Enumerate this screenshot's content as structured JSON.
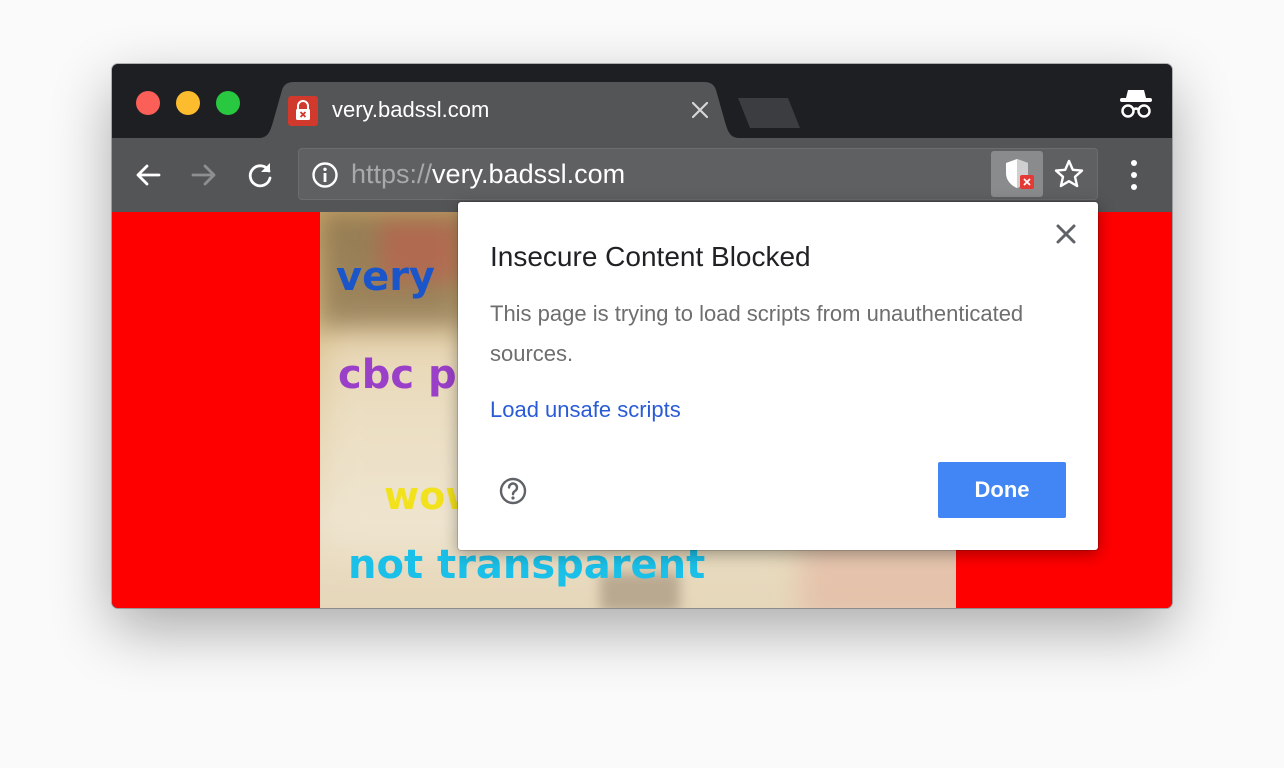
{
  "window": {
    "traffic_lights": {
      "close": "#fc5f57",
      "minimize": "#fdbc2e",
      "maximize": "#28c840"
    }
  },
  "tab": {
    "title": "very.badssl.com",
    "favicon_icon": "lock-error-icon",
    "close_icon": "close-icon"
  },
  "toolbar": {
    "back_icon": "arrow-left-icon",
    "forward_icon": "arrow-right-icon",
    "reload_icon": "reload-icon",
    "omnibox": {
      "info_icon": "info-icon",
      "url_scheme": "https://",
      "url_host": "very.badssl.com",
      "shield_icon": "shield-blocked-icon",
      "star_icon": "star-icon"
    },
    "menu_icon": "vertical-dots-icon",
    "incognito_icon": "incognito-icon"
  },
  "page": {
    "background": "#ff0000",
    "image_text": [
      "very",
      "cbc p",
      "wow",
      "not transparent"
    ]
  },
  "popup": {
    "title": "Insecure Content Blocked",
    "message": "This page is trying to load scripts from unauthenticated sources.",
    "link": "Load unsafe scripts",
    "help_icon": "help-circle-icon",
    "done_label": "Done",
    "done_color": "#4285f4",
    "link_color": "#2a5bd7"
  }
}
